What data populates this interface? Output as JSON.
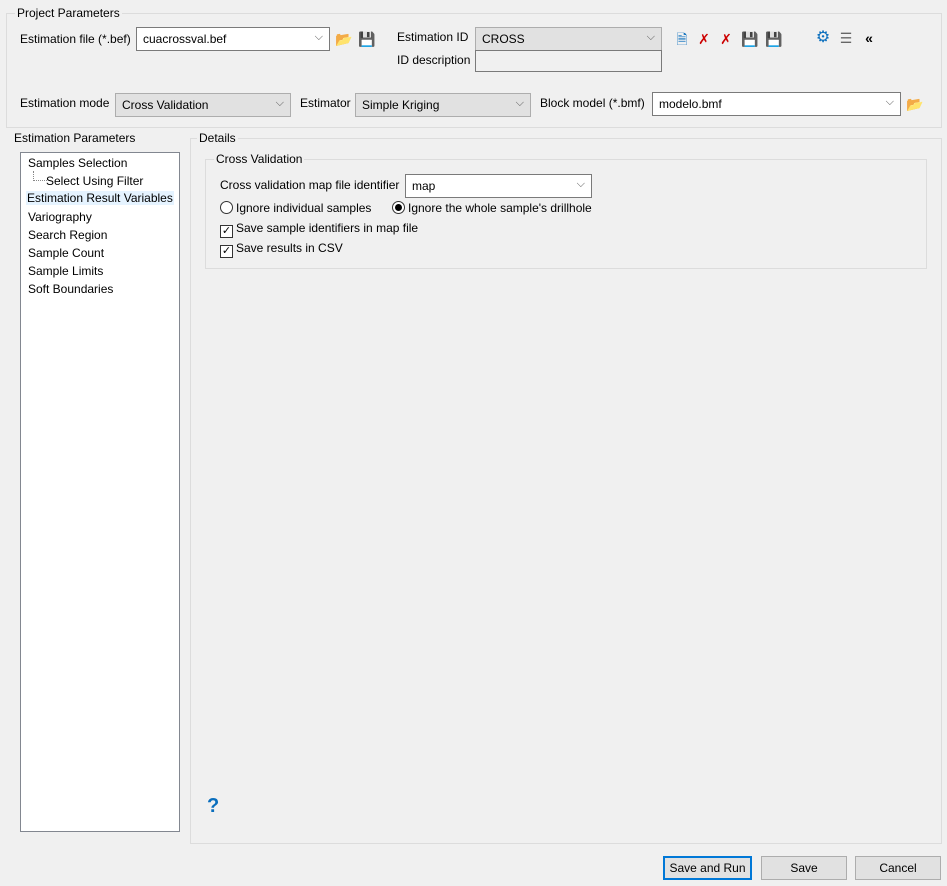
{
  "project": {
    "title": "Project Parameters",
    "estimation_file_label": "Estimation file (*.bef)",
    "estimation_file": "cuacrossval.bef",
    "estimation_id_label": "Estimation ID",
    "estimation_id": "CROSS",
    "id_description_label": "ID description",
    "id_description": "",
    "estimation_mode_label": "Estimation mode",
    "estimation_mode": "Cross Validation",
    "estimator_label": "Estimator",
    "estimator": "Simple Kriging",
    "block_model_label": "Block model (*.bmf)",
    "block_model": "modelo.bmf"
  },
  "left": {
    "title": "Estimation Parameters",
    "items": [
      "Samples Selection",
      "Select Using Filter",
      "Estimation Result Variables",
      "Variography",
      "Search Region",
      "Sample Count",
      "Sample Limits",
      "Soft Boundaries"
    ],
    "selected": "Estimation Result Variables"
  },
  "details": {
    "title": "Details",
    "group_title": "Cross Validation",
    "map_id_label": "Cross validation map file identifier",
    "map_id": "map",
    "radio_individual": "Ignore individual samples",
    "radio_drillhole": "Ignore the whole sample's drillhole",
    "radio_selected": "drillhole",
    "chk_identifiers": "Save sample identifiers in map file",
    "chk_identifiers_checked": true,
    "chk_csv": "Save results in CSV",
    "chk_csv_checked": true,
    "help": "?"
  },
  "buttons": {
    "save_run": "Save and Run",
    "save": "Save",
    "cancel": "Cancel"
  }
}
